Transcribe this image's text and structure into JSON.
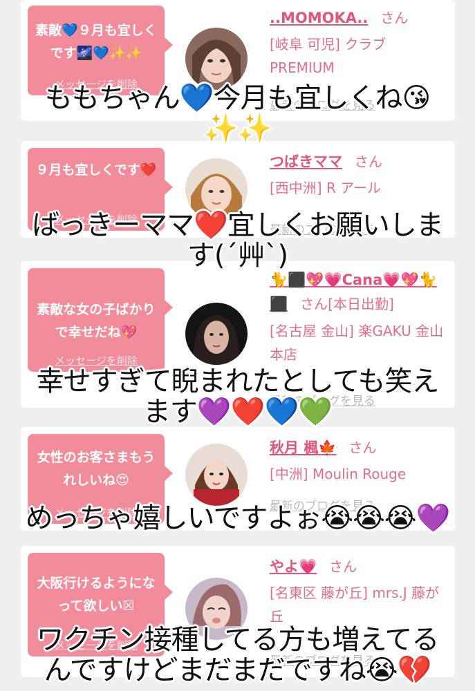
{
  "cards": [
    {
      "message": "素敵💙９月も宜しくです🌌💙✨✨",
      "delete_label": "メッセージを削除",
      "name": "..MOMOKA..",
      "san": "さん",
      "shop": "[岐阜 可児] クラブ PREMIUM",
      "blog": "最新のブログを見る"
    },
    {
      "message": "９月も宜しくです❤️",
      "delete_label": "メッセージを削除",
      "name": "つばきママ",
      "san": "さん",
      "shop": "[西中洲] R アール",
      "blog": "最新のブログを見る"
    },
    {
      "message": "素敵な女の子ばかりで幸せだね💖",
      "delete_label": "メッセージを削除",
      "name": "🐈⬛💖💗Cana💗💖🐈⬛",
      "san": "さん",
      "status": "[本日出勤]",
      "shop": "[名古屋 金山] 楽GAKU 金山本店",
      "blog": "最新のブログを見る"
    },
    {
      "message": "女性のお客さまもうれしいね😍",
      "delete_label": "メッセージを削除",
      "name": "秋月 楓🍁",
      "san": "さん",
      "shop": "[中洲] Moulin Rouge",
      "blog": "最新のブログを見る"
    },
    {
      "message": "大阪行けるようになって欲しい☒",
      "delete_label": "メッセージを削除",
      "name": "やよ💗",
      "san": "さん",
      "shop": "[名東区 藤が丘] mrs.J 藤が丘",
      "blog": "最新のブログを見る"
    }
  ],
  "captions": [
    [
      "ももちゃん💙今月も宜しくね😘",
      "✨✨"
    ],
    [
      "ばっきーママ❤️宜しくお願いしま",
      "す(´艸`)"
    ],
    [
      "幸せすぎて睨まれたとしても笑え",
      "ます💜❤️💙💚"
    ],
    [
      "めっちゃ嬉しいですよぉ😭😭😭💜"
    ],
    [
      "ワクチン接種してる方も増えてる",
      "んですけどまだまだですね😭💔"
    ]
  ],
  "colors": {
    "bubble": "#f28b9a",
    "name": "#e0567b",
    "background": "#efefef"
  }
}
